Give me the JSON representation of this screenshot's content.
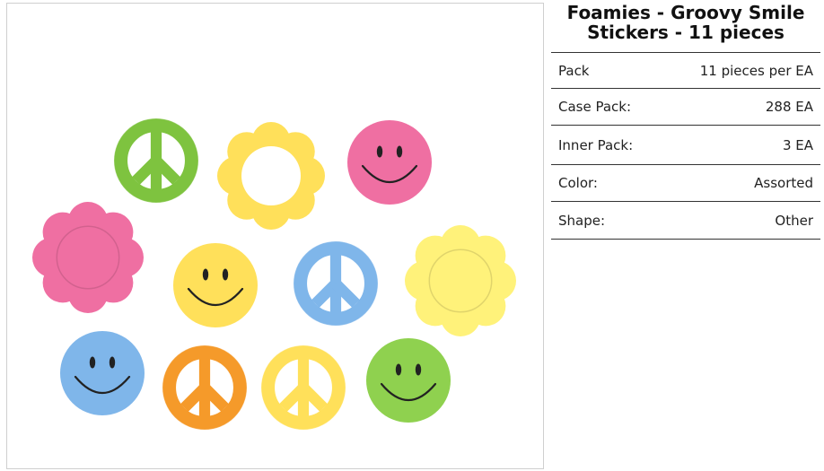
{
  "product": {
    "title": "Foamies - Groovy Smile Stickers - 11 pieces"
  },
  "specs": [
    {
      "label": "Pack",
      "value": "11 pieces per EA"
    },
    {
      "label": "Case Pack:",
      "value": "288 EA"
    },
    {
      "label": "Inner Pack:",
      "value": "3 EA"
    },
    {
      "label": "Color:",
      "value": "Assorted"
    },
    {
      "label": "Shape:",
      "value": "Other"
    }
  ],
  "colors": {
    "green": "#7ec33f",
    "yellow": "#ffe05a",
    "pink": "#ef6fa2",
    "blue": "#7fb6ea",
    "orange": "#f59a2a",
    "light_green": "#8fd14f",
    "pale_yellow": "#fff27a"
  },
  "stickers": [
    {
      "shape": "peace",
      "color": "green"
    },
    {
      "shape": "flower-ring",
      "color": "yellow"
    },
    {
      "shape": "smiley",
      "color": "pink"
    },
    {
      "shape": "flower",
      "color": "pink"
    },
    {
      "shape": "smiley",
      "color": "yellow"
    },
    {
      "shape": "peace",
      "color": "blue"
    },
    {
      "shape": "flower",
      "color": "pale_yellow"
    },
    {
      "shape": "smiley",
      "color": "blue"
    },
    {
      "shape": "peace",
      "color": "orange"
    },
    {
      "shape": "peace",
      "color": "yellow"
    },
    {
      "shape": "smiley",
      "color": "light_green"
    }
  ]
}
